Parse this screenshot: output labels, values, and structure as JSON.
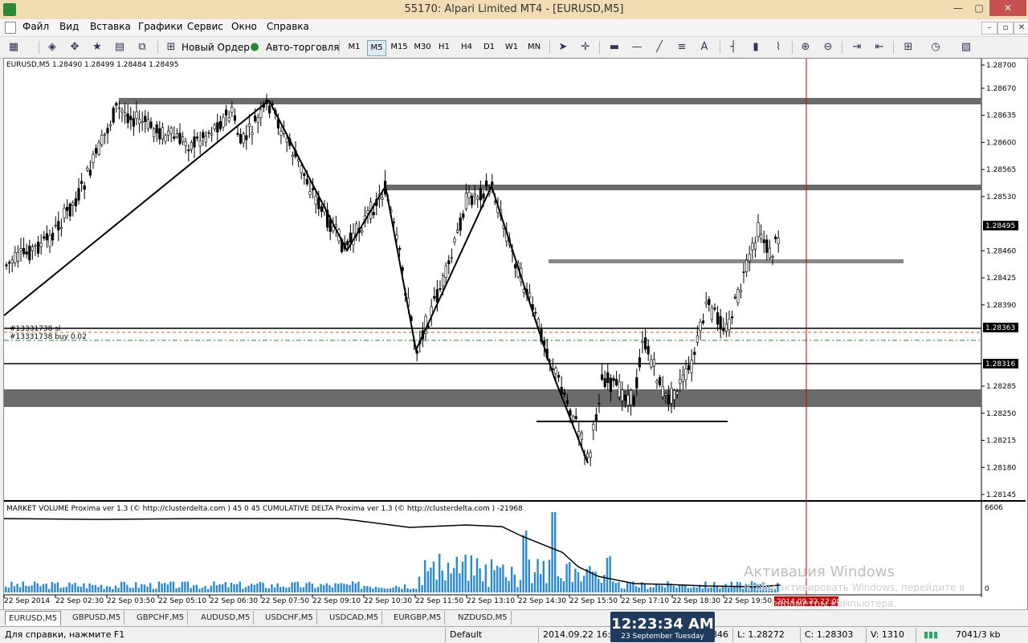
{
  "window": {
    "title": "55170: Alpari Limited MT4 - [EURUSD,M5]",
    "min": "—",
    "max": "▢",
    "close": "✕"
  },
  "menu": {
    "items": [
      "Файл",
      "Вид",
      "Вставка",
      "Графики",
      "Сервис",
      "Окно",
      "Справка"
    ],
    "mdi": [
      "–",
      "▫",
      "✕"
    ]
  },
  "toolbar": {
    "new_order": "Новый Ордер",
    "auto_trading": "Авто-торговля",
    "timeframes": [
      "M1",
      "M5",
      "M15",
      "M30",
      "H1",
      "H4",
      "D1",
      "W1",
      "MN"
    ],
    "active_timeframe": "M5",
    "text_tool": "A"
  },
  "chart": {
    "header": "EURUSD,M5  1.28490 1.28499 1.28484 1.28495",
    "price_labels": [
      "1.28700",
      "1.28670",
      "1.28635",
      "1.28600",
      "1.28565",
      "1.28530",
      "1.28495",
      "1.28460",
      "1.28425",
      "1.28390",
      "1.28363",
      "1.28316",
      "1.28285",
      "1.28250",
      "1.28215",
      "1.28180",
      "1.28145"
    ],
    "current_price": "1.28495",
    "sl_price": "1.28363",
    "hline_price": "1.28316",
    "order_sl_label": "#13331738 sl",
    "order_buy_label": "#13331738 buy 0.02",
    "time_labels": [
      "22 Sep 2014",
      "22 Sep 02:30",
      "22 Sep 03:50",
      "22 Sep 05:10",
      "22 Sep 06:30",
      "22 Sep 07:50",
      "22 Sep 09:10",
      "22 Sep 10:30",
      "22 Sep 11:50",
      "22 Sep 13:10",
      "22 Sep 14:30",
      "22 Sep 15:50",
      "22 Sep 17:10",
      "22 Sep 18:30",
      "22 Sep 19:50"
    ],
    "time_cursor_label": "2014.09.22 22:00",
    "indicator_header": "MARKET VOLUME Proxima ver 1.3 (© http://clusterdelta.com ) 45 0 45   CUMULATIVE DELTA Proxima ver 1.3 (© http://clusterdelta.com ) -21968",
    "indicator_max": "6606",
    "indicator_zero": "0"
  },
  "watermark": {
    "line1": "Активация Windows",
    "line2": "Чтобы активировать Windows, перейдите в",
    "line3": "параметры компьютера."
  },
  "tabs": [
    "EURUSD,M5",
    "GBPUSD,M5",
    "GBPCHF,M5",
    "AUDUSD,M5",
    "USDCHF,M5",
    "USDCAD,M5",
    "EURGBP,M5",
    "NZDUSD,M5"
  ],
  "active_tab": "EURUSD,M5",
  "status": {
    "help": "Для справки, нажмите F1",
    "profile": "Default",
    "datetime": "2014.09.22 16:25",
    "partial": "846",
    "low": "L: 1.28272",
    "close": "C: 1.28303",
    "volume": "V: 1310",
    "traffic": "7041/3 kb"
  },
  "clock": {
    "time": "12:23:34 AM",
    "date": "23 September Tuesday"
  },
  "colors": {
    "titlebar": "#f2dcb4",
    "zone": "#6b6b6b",
    "candle": "#000000",
    "volume_bar": "#2a8ad4",
    "cursor_line": "#cc0000",
    "price_tag": "#000000"
  }
}
